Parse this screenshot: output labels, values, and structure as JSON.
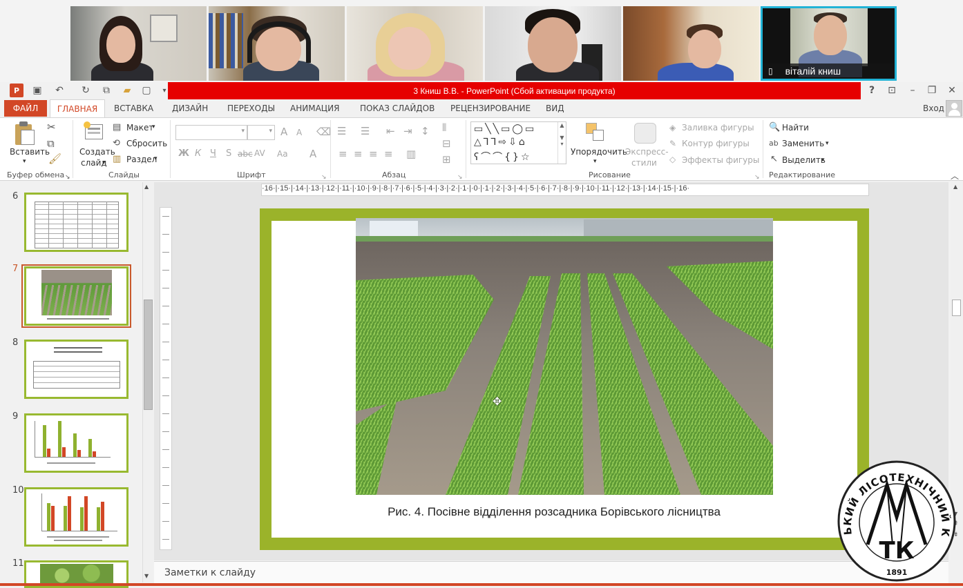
{
  "video": {
    "active_name": "віталій книш"
  },
  "window": {
    "title": "3 Книш В.В. -  PowerPoint (Сбой активации продукта)",
    "help": "?",
    "signin": "Вход"
  },
  "tabs": [
    "ФАЙЛ",
    "ГЛАВНАЯ",
    "ВСТАВКА",
    "ДИЗАЙН",
    "ПЕРЕХОДЫ",
    "АНИМАЦИЯ",
    "ПОКАЗ СЛАЙДОВ",
    "РЕЦЕНЗИРОВАНИЕ",
    "ВИД"
  ],
  "ribbon": {
    "clipboard": {
      "paste": "Вставить",
      "label": "Буфер обмена"
    },
    "slides": {
      "new1": "Создать",
      "new2": "слайд",
      "layout": "Макет",
      "reset": "Сбросить",
      "section": "Раздел",
      "label": "Слайды"
    },
    "font": {
      "label": "Шрифт",
      "bold": "Ж",
      "italic": "К",
      "underline": "Ч",
      "shadow": "S",
      "strike": "abc",
      "spacing": "AV",
      "case": "Aa",
      "grow": "A",
      "shrink": "A",
      "color": "A"
    },
    "paragraph": {
      "label": "Абзац"
    },
    "drawing": {
      "arrange": "Упорядочить",
      "styles1": "Экспресс-",
      "styles2": "стили",
      "fill": "Заливка фигуры",
      "outline": "Контур фигуры",
      "effects": "Эффекты фигуры",
      "label": "Рисование"
    },
    "editing": {
      "find": "Найти",
      "replace": "Заменить",
      "select": "Выделить",
      "label": "Редактирование"
    }
  },
  "thumbnails": [
    "6",
    "7",
    "8",
    "9",
    "10",
    "11"
  ],
  "ruler_h": "·16·|·15·|·14·|·13·|·12·|·11·|·10·|·9·|·8·|·7·|·6·|·5·|·4·|·3·|·2·|·1·|·0·|·1·|·2·|·3·|·4·|·5·|·6·|·7·|·8·|·9·|·10·|·11·|·12·|·13·|·14·|·15·|·16·",
  "slide": {
    "caption": "Рис. 4. Посівне відділення розсадника Борівського лісництва"
  },
  "notes": "Заметки к слайду",
  "logo": {
    "arc_text": "ЛУБЕНСЬКИЙ ЛІСОТЕХНІЧНИЙ КОЛЕДЖ",
    "initials": "ТК",
    "year": "1891"
  },
  "colors": {
    "accent": "#d24726",
    "title_bar": "#e60000",
    "slide_border": "#9bb32a",
    "active_video": "#21b3d6"
  }
}
